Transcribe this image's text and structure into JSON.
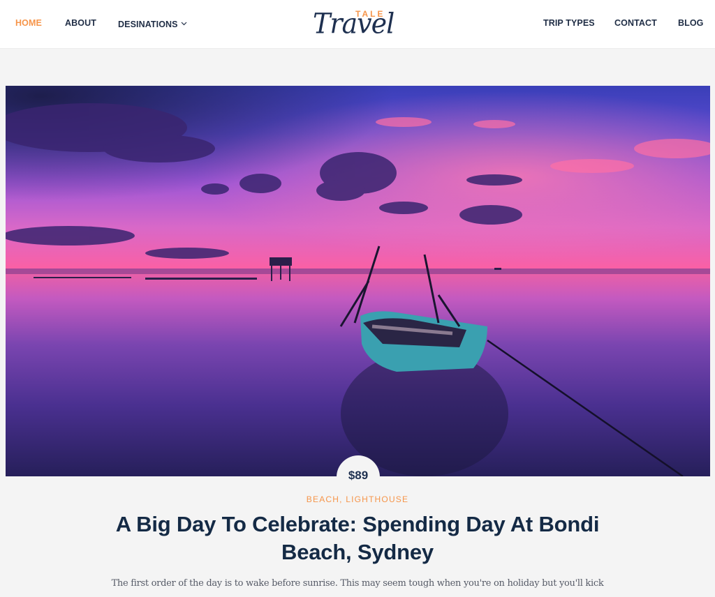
{
  "header": {
    "nav_left": [
      {
        "label": "HOME",
        "active": true
      },
      {
        "label": "ABOUT",
        "active": false
      },
      {
        "label": "DESINATIONS",
        "active": false,
        "has_dropdown": true
      }
    ],
    "nav_right": [
      {
        "label": "TRIP TYPES"
      },
      {
        "label": "CONTACT"
      },
      {
        "label": "BLOG"
      }
    ],
    "logo": {
      "top_text": "TALE",
      "script_text": "Travel"
    },
    "dropdown_icon": "chevron-down-icon"
  },
  "post": {
    "image_alt": "Wooden boat on calm water at a purple and pink sunset",
    "price": "$89",
    "categories": [
      "BEACH",
      "LIGHTHOUSE"
    ],
    "category_separator": ", ",
    "title": "A Big Day To Celebrate: Spending Day At Bondi Beach, Sydney",
    "excerpt": "The first order of the day is to wake before sunrise. This may seem tough when you're on holiday but you'll kick"
  },
  "colors": {
    "accent": "#f6954a",
    "heading": "#142a45",
    "nav_text": "#1f2d45",
    "page_bg": "#f4f4f4",
    "header_bg": "#ffffff"
  }
}
